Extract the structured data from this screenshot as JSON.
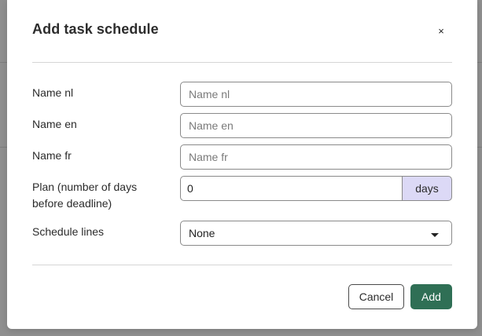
{
  "modal": {
    "title": "Add task schedule",
    "close_label": "×"
  },
  "form": {
    "name_nl": {
      "label": "Name nl",
      "placeholder": "Name nl",
      "value": ""
    },
    "name_en": {
      "label": "Name en",
      "placeholder": "Name en",
      "value": ""
    },
    "name_fr": {
      "label": "Name fr",
      "placeholder": "Name fr",
      "value": ""
    },
    "plan": {
      "label": "Plan (number of days before deadline)",
      "value": "0",
      "unit": "days"
    },
    "schedule_lines": {
      "label": "Schedule lines",
      "selected": "None"
    }
  },
  "buttons": {
    "cancel": "Cancel",
    "add": "Add"
  },
  "colors": {
    "primary": "#2f6f55",
    "addon_bg": "#dcd9f6"
  }
}
